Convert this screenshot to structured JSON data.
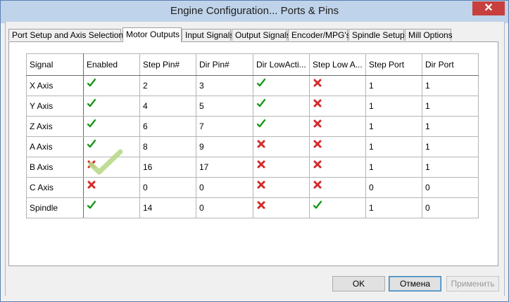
{
  "window": {
    "title": "Engine Configuration... Ports & Pins",
    "close_symbol": "✕"
  },
  "tabs": [
    {
      "label": "Port Setup and Axis Selection",
      "active": false
    },
    {
      "label": "Motor Outputs",
      "active": true
    },
    {
      "label": "Input Signals",
      "active": false
    },
    {
      "label": "Output Signals",
      "active": false
    },
    {
      "label": "Encoder/MPG's",
      "active": false
    },
    {
      "label": "Spindle Setup",
      "active": false
    },
    {
      "label": "Mill Options",
      "active": false
    }
  ],
  "table": {
    "headers": [
      "Signal",
      "Enabled",
      "Step Pin#",
      "Dir Pin#",
      "Dir LowActi...",
      "Step Low A...",
      "Step Port",
      "Dir Port"
    ],
    "rows": [
      {
        "signal": "X Axis",
        "enabled": "check",
        "step_pin": "2",
        "dir_pin": "3",
        "dir_low": "check",
        "step_low": "cross",
        "step_port": "1",
        "dir_port": "1"
      },
      {
        "signal": "Y Axis",
        "enabled": "check",
        "step_pin": "4",
        "dir_pin": "5",
        "dir_low": "check",
        "step_low": "cross",
        "step_port": "1",
        "dir_port": "1"
      },
      {
        "signal": "Z Axis",
        "enabled": "check",
        "step_pin": "6",
        "dir_pin": "7",
        "dir_low": "check",
        "step_low": "cross",
        "step_port": "1",
        "dir_port": "1"
      },
      {
        "signal": "A Axis",
        "enabled": "check",
        "step_pin": "8",
        "dir_pin": "9",
        "dir_low": "cross",
        "step_low": "cross",
        "step_port": "1",
        "dir_port": "1"
      },
      {
        "signal": "B Axis",
        "enabled": "cross",
        "step_pin": "16",
        "dir_pin": "17",
        "dir_low": "cross",
        "step_low": "cross",
        "step_port": "1",
        "dir_port": "1"
      },
      {
        "signal": "C Axis",
        "enabled": "cross",
        "step_pin": "0",
        "dir_pin": "0",
        "dir_low": "cross",
        "step_low": "cross",
        "step_port": "0",
        "dir_port": "0"
      },
      {
        "signal": "Spindle",
        "enabled": "check",
        "step_pin": "14",
        "dir_pin": "0",
        "dir_low": "cross",
        "step_low": "check",
        "step_port": "1",
        "dir_port": "0"
      }
    ]
  },
  "buttons": {
    "ok": "OK",
    "cancel": "Отмена",
    "apply": "Применить"
  },
  "colors": {
    "check": "#2fb52f",
    "cross": "#d42a2a",
    "highlight_check": "#b9d98a"
  },
  "icons": {
    "check": "check-icon",
    "cross": "cross-icon"
  }
}
